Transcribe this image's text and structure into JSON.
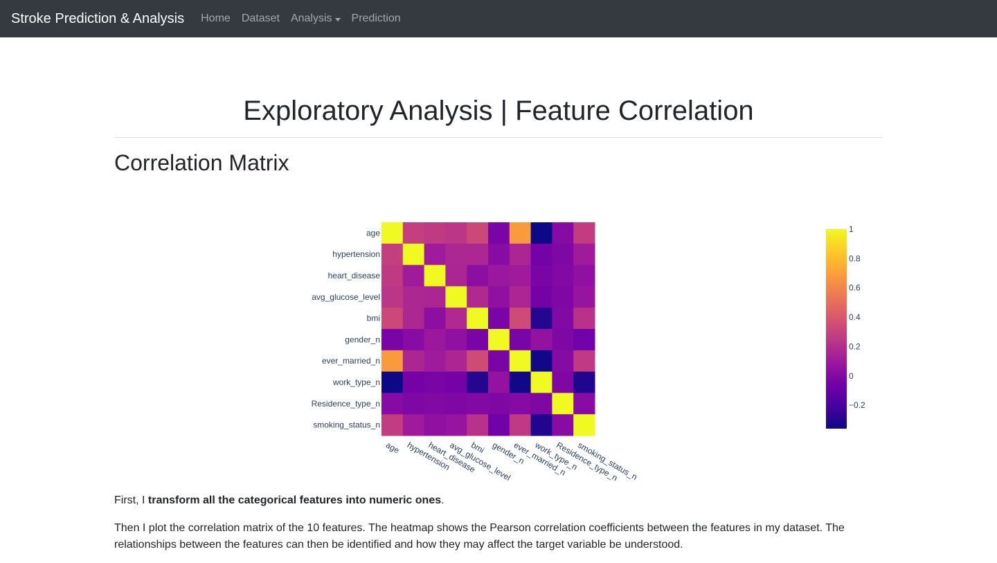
{
  "navbar": {
    "brand": "Stroke Prediction & Analysis",
    "items": [
      {
        "label": "Home",
        "dropdown": false
      },
      {
        "label": "Dataset",
        "dropdown": false
      },
      {
        "label": "Analysis",
        "dropdown": true
      },
      {
        "label": "Prediction",
        "dropdown": false
      }
    ]
  },
  "page": {
    "heading": "Exploratory Analysis | Feature Correlation",
    "section_title": "Correlation Matrix"
  },
  "text": {
    "p1_before": "First, I ",
    "p1_bold": "transform all the categorical features into numeric ones",
    "p1_after": ".",
    "p2": "Then I plot the correlation matrix of the 10 features. The heatmap shows the Pearson correlation coefficients between the features in my dataset. The relationships between the features can then be identified and how they may affect the target variable be understood."
  },
  "colors": {
    "navbar_bg": "#343a40",
    "colorscale": [
      "#0d0887",
      "#46039f",
      "#7201a8",
      "#9c179e",
      "#bd3786",
      "#d8576b",
      "#ed7953",
      "#fb9f3a",
      "#fdca26",
      "#f0f921"
    ]
  },
  "chart_data": {
    "type": "heatmap",
    "title": "",
    "features": [
      "age",
      "hypertension",
      "heart_disease",
      "avg_glucose_level",
      "bmi",
      "gender_n",
      "ever_married_n",
      "work_type_n",
      "Residence_type_n",
      "smoking_status_n"
    ],
    "matrix": [
      [
        1.0,
        0.28,
        0.26,
        0.24,
        0.33,
        -0.03,
        0.68,
        -0.36,
        0.01,
        0.27
      ],
      [
        0.28,
        1.0,
        0.11,
        0.17,
        0.17,
        0.02,
        0.16,
        -0.05,
        -0.01,
        0.11
      ],
      [
        0.26,
        0.11,
        1.0,
        0.16,
        0.04,
        0.09,
        0.11,
        -0.03,
        0.0,
        0.05
      ],
      [
        0.24,
        0.17,
        0.16,
        1.0,
        0.18,
        0.05,
        0.16,
        -0.05,
        -0.01,
        0.07
      ],
      [
        0.33,
        0.17,
        0.04,
        0.18,
        1.0,
        -0.03,
        0.34,
        -0.3,
        0.0,
        0.22
      ],
      [
        -0.03,
        0.02,
        0.09,
        0.05,
        -0.03,
        1.0,
        -0.03,
        0.06,
        -0.01,
        -0.06
      ],
      [
        0.68,
        0.16,
        0.11,
        0.16,
        0.34,
        -0.03,
        1.0,
        -0.35,
        0.01,
        0.26
      ],
      [
        -0.36,
        -0.05,
        -0.03,
        -0.05,
        -0.3,
        0.06,
        -0.35,
        1.0,
        -0.01,
        -0.31
      ],
      [
        0.01,
        -0.01,
        0.0,
        -0.01,
        0.0,
        -0.01,
        0.01,
        -0.01,
        1.0,
        0.02
      ],
      [
        0.27,
        0.11,
        0.05,
        0.07,
        0.22,
        -0.06,
        0.26,
        -0.31,
        0.02,
        1.0
      ]
    ],
    "zmin": -0.36,
    "zmax": 1.0,
    "colorbar": {
      "tickvals": [
        1,
        0.8,
        0.6,
        0.4,
        0.2,
        0,
        -0.2
      ],
      "ticklabels": [
        "1",
        "0.8",
        "0.6",
        "0.4",
        "0.2",
        "0",
        "−0.2"
      ]
    },
    "grid": false,
    "legend": "colorbar-right"
  }
}
